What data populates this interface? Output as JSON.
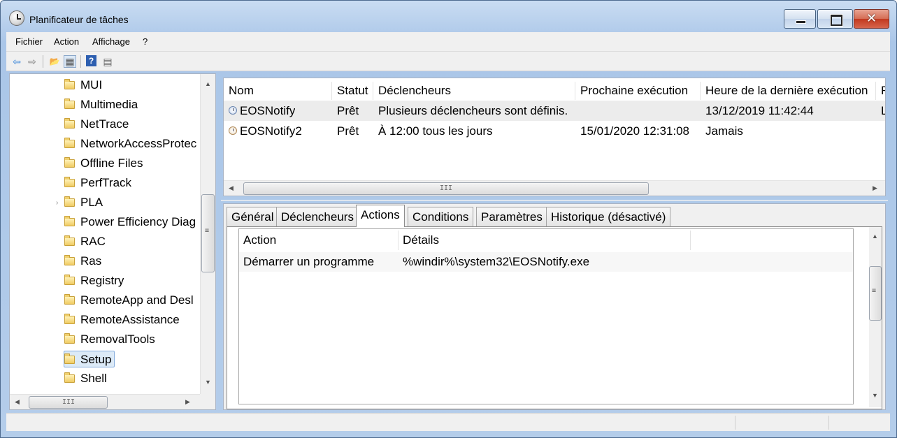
{
  "window": {
    "title": "Planificateur de tâches",
    "close_glyph": "✕"
  },
  "menu": [
    "Fichier",
    "Action",
    "Affichage",
    "?"
  ],
  "toolbar": {
    "icons": [
      "back-arrow-icon",
      "forward-arrow-icon",
      "up-folder-icon",
      "show-hide-console-tree-icon",
      "help-icon",
      "show-hide-action-pane-icon"
    ],
    "glyphs": {
      "back": "⇦",
      "forward": "⇨",
      "up": "📂",
      "tree": "▦",
      "help": "?",
      "pane": "▤"
    }
  },
  "tree": {
    "items": [
      "MUI",
      "Multimedia",
      "NetTrace",
      "NetworkAccessProtec",
      "Offline Files",
      "PerfTrack",
      "PLA",
      "Power Efficiency Diag",
      "RAC",
      "Ras",
      "Registry",
      "RemoteApp and Desl",
      "RemoteAssistance",
      "RemovalTools",
      "Setup",
      "Shell"
    ],
    "selected": "Setup",
    "expander_glyph": "›"
  },
  "scroll": {
    "up": "▲",
    "down": "▼",
    "left": "◀",
    "right": "▶",
    "grip_v": "≡",
    "grip_h": "III"
  },
  "tasks": {
    "columns": [
      "Nom",
      "Statut",
      "Déclencheurs",
      "Prochaine exécution",
      "Heure de la dernière exécution",
      "F"
    ],
    "rows": [
      {
        "name": "EOSNotify",
        "status": "Prêt",
        "triggers": "Plusieurs déclencheurs sont définis.",
        "next": "",
        "last": "13/12/2019 11:42:44",
        "extra": "L"
      },
      {
        "name": "EOSNotify2",
        "status": "Prêt",
        "triggers": "À 12:00 tous les jours",
        "next": "15/01/2020 12:31:08",
        "last": "Jamais",
        "extra": ""
      }
    ]
  },
  "tabs": [
    "Général",
    "Déclencheurs",
    "Actions",
    "Conditions",
    "Paramètres",
    "Historique (désactivé)"
  ],
  "active_tab": "Actions",
  "actions": {
    "columns": [
      "Action",
      "Détails"
    ],
    "rows": [
      {
        "action": "Démarrer un programme",
        "details": "%windir%\\system32\\EOSNotify.exe"
      }
    ]
  }
}
